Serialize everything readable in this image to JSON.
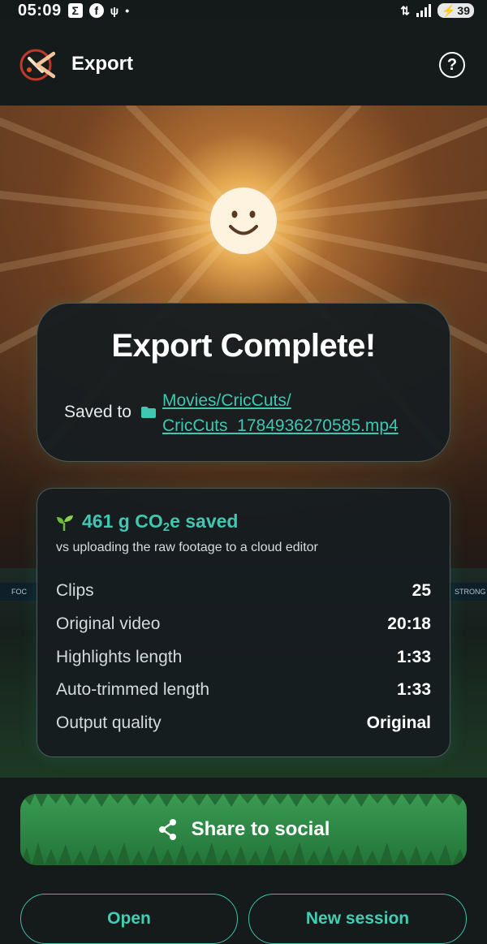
{
  "status_bar": {
    "time": "05:09",
    "battery": "39"
  },
  "app_bar": {
    "title": "Export"
  },
  "export": {
    "title": "Export Complete!",
    "saved_label": "Saved to",
    "path_line1": "Movies/CricCuts/",
    "path_line2": "CricCuts_1784936270585.mp4"
  },
  "co2": {
    "amount": "461 g CO",
    "subscript": "2",
    "suffix": "e saved",
    "description": "vs uploading the raw footage to a cloud editor"
  },
  "stats": [
    {
      "label": "Clips",
      "value": "25"
    },
    {
      "label": "Original video",
      "value": "20:18"
    },
    {
      "label": "Highlights length",
      "value": "1:33"
    },
    {
      "label": "Auto-trimmed length",
      "value": "1:33"
    },
    {
      "label": "Output quality",
      "value": "Original"
    }
  ],
  "stadium": {
    "banner_left": "FOC",
    "banner_right": "STRONG"
  },
  "actions": {
    "share_label": "Share to social",
    "open_label": "Open",
    "new_session_label": "New session"
  },
  "colors": {
    "accent": "#3fc7b2",
    "share_green": "#2f8a47",
    "background": "#151b1a"
  }
}
